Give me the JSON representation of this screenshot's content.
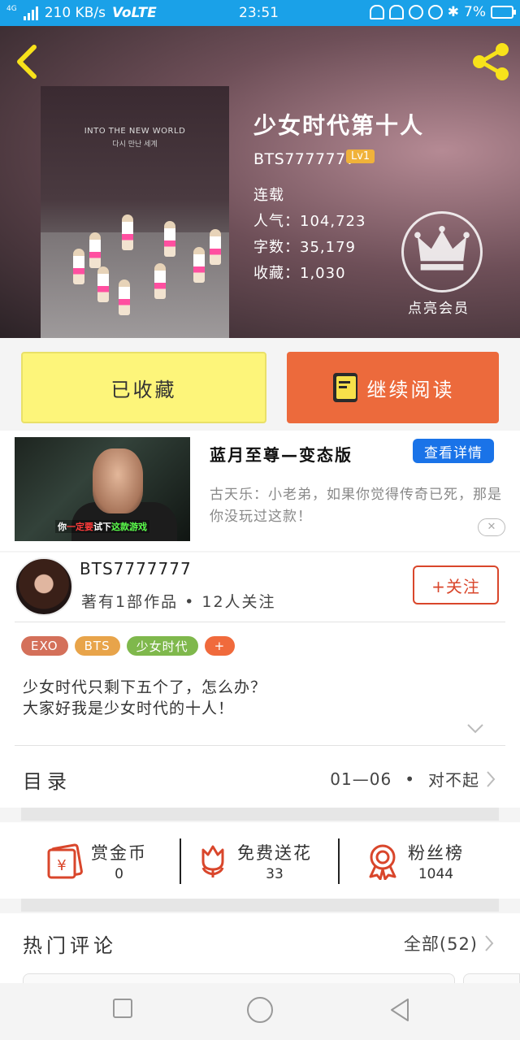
{
  "status_bar": {
    "network_speed": "210 KB/s",
    "volte": "VoLTE",
    "time": "23:51",
    "battery": "7%",
    "net_type": "4G"
  },
  "book": {
    "title": "少女时代第十人",
    "author": "BTS7777777",
    "level": "Lv1",
    "status": "连载",
    "popularity": "人气：104,723",
    "word_count": "字数：35,179",
    "favorites": "收藏：1,030",
    "vip_label": "点亮会员",
    "cover_text_en": "INTO THE NEW WORLD",
    "cover_text_ko": "다시 만난 세계"
  },
  "actions": {
    "collected_label": "已收藏",
    "continue_label": "继续阅读"
  },
  "ad": {
    "title": "蓝月至尊—变态版",
    "button": "查看详情",
    "desc": "古天乐：小老弟，如果你觉得传奇已死，那是你没玩过这款！",
    "caption_1": "你",
    "caption_2": "一定要",
    "caption_3": "试下",
    "caption_4": "这款游戏",
    "close": "✕"
  },
  "author_info": {
    "name": "BTS7777777",
    "summary": "著有1部作品 • 12人关注",
    "follow": "+关注"
  },
  "tags": [
    {
      "label": "EXO",
      "color": "#d4705a"
    },
    {
      "label": "BTS",
      "color": "#e8a44a"
    },
    {
      "label": "少女时代",
      "color": "#7fb84c"
    },
    {
      "label": "+",
      "color": "#f06a3c"
    }
  ],
  "description": {
    "line1": "少女时代只剩下五个了，怎么办？",
    "line2": "大家好我是少女时代的十人！"
  },
  "toc": {
    "label": "目录",
    "latest": "01—06",
    "dot": "•",
    "chapter": "对不起"
  },
  "rewards": [
    {
      "label": "赏金币",
      "value": "0",
      "icon": "red-envelope-yen-icon"
    },
    {
      "label": "免费送花",
      "value": "33",
      "icon": "flower-icon"
    },
    {
      "label": "粉丝榜",
      "value": "1044",
      "icon": "medal-icon"
    }
  ],
  "comments": {
    "label": "热门评论",
    "all": "全部(52)"
  },
  "colors": {
    "status_bar": "#1aa1e8",
    "favorite_button": "#fdf57a",
    "read_button": "#ec6a3c",
    "accent_red": "#d9462b",
    "level_badge": "#f0b23a",
    "ad_button": "#1a73e8"
  }
}
